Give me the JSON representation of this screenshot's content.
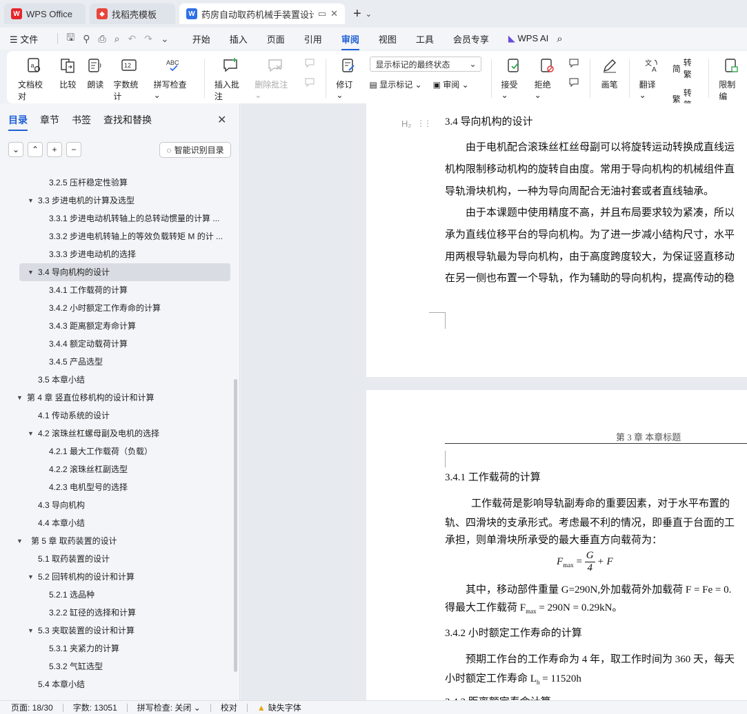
{
  "tabs": [
    {
      "label": "WPS Office"
    },
    {
      "label": "找稻壳模板"
    },
    {
      "label": "药房自动取药机械手装置设计"
    }
  ],
  "menu": {
    "file": "文件",
    "items": [
      "开始",
      "插入",
      "页面",
      "引用",
      "审阅",
      "视图",
      "工具",
      "会员专享"
    ],
    "wpsai": "WPS AI"
  },
  "ribbon": {
    "doc_check": "文档校对",
    "compare": "比较",
    "read": "朗读",
    "word_count": "字数统计",
    "spell_check": "拼写检查",
    "spell_icon_text": "ABC",
    "count_icon_text": "12",
    "insert_comment": "插入批注",
    "delete_comment": "删除批注",
    "revise": "修订",
    "display_mode": "显示标记的最终状态",
    "show_marks": "显示标记",
    "review": "审阅",
    "accept": "接受",
    "reject": "拒绝",
    "brush": "画笔",
    "translate": "翻译",
    "to_traditional": "转繁",
    "to_simplified": "转简",
    "restrict_edit": "限制编"
  },
  "nav": {
    "tabs": [
      "目录",
      "章节",
      "书签",
      "查找和替换"
    ],
    "smart_btn": "智能识别目录",
    "toc": [
      {
        "label": "3.2.5 压杆稳定性验算"
      },
      {
        "label": "3.3 步进电机的计算及选型"
      },
      {
        "label": "3.3.1 步进电动机转轴上的总转动惯量的计算 ..."
      },
      {
        "label": "3.3.2 步进电机转轴上的等效负载转矩 M 的计 ..."
      },
      {
        "label": "3.3.3 步进电动机的选择"
      },
      {
        "label": "3.4 导向机构的设计"
      },
      {
        "label": "3.4.1  工作载荷的计算"
      },
      {
        "label": "3.4.2 小时额定工作寿命的计算"
      },
      {
        "label": "3.4.3 距离额定寿命计算"
      },
      {
        "label": "3.4.4 额定动载荷计算"
      },
      {
        "label": "3.4.5  产品选型"
      },
      {
        "label": "3.5 本章小结"
      },
      {
        "label": "第 4 章  竖直位移机构的设计和计算"
      },
      {
        "label": "4.1 传动系统的设计"
      },
      {
        "label": "4.2 滚珠丝杠螺母副及电机的选择"
      },
      {
        "label": "4.2.1 最大工作载荷（负载）"
      },
      {
        "label": "4.2.2 滚珠丝杠副选型"
      },
      {
        "label": "4.2.3 电机型号的选择"
      },
      {
        "label": "4.3  导向机构"
      },
      {
        "label": "4.4  本章小结"
      },
      {
        "label": "第 5 章  取药装置的设计"
      },
      {
        "label": "5.1 取药装置的设计"
      },
      {
        "label": "5.2  回转机构的设计和计算"
      },
      {
        "label": "5.2.1 选品种"
      },
      {
        "label": "3.2.2 缸径的选择和计算"
      },
      {
        "label": "5.3  夹取装置的设计和计算"
      },
      {
        "label": "5.3.1  夹紧力的计算"
      },
      {
        "label": "5.3.2  气缸选型"
      },
      {
        "label": "5.4  本章小结"
      }
    ]
  },
  "doc": {
    "h2_marker": "H₂",
    "p1_heading": "3.4 导向机构的设计",
    "p1_lines": [
      "由于电机配合滚珠丝杠丝母副可以将旋转运动转换成直线运",
      "机构限制移动机构的旋转自由度。常用于导向机构的机械组件直",
      "导轨滑块机构，一种为导向周配合无油衬套或者直线轴承。",
      "由于本课题中使用精度不高，并且布局要求较为紧凑，所以",
      "承为直线位移平台的导向机构。为了进一步减小结构尺寸，水平",
      "用两根导轨最为导向机构，由于高度跨度较大，为保证竖直移动",
      "在另一侧也布置一个导轨，作为辅助的导向机构，提高传动的稳"
    ],
    "running_header": "第 3 章  本章标题",
    "sec341": "3.4.1  工作载荷的计算",
    "p2_lines": [
      "工作载荷是影响导轨副寿命的重要因素，对于水平布置的",
      "轨、四滑块的支承形式。考虑最不利的情况，即垂直于台面的工",
      "承担，则单滑块所承受的最大垂直方向载荷为："
    ],
    "formula": {
      "lhs": "F",
      "lhs_sub": "max",
      "num": "G",
      "den": "4",
      "tail": "+ F"
    },
    "p3_line1": "其中，移动部件重量 G=290N,外加载荷外加载荷 F = Fe = 0.",
    "p3_line2": "得最大工作载荷 F",
    "p3_line2_sub": "max",
    "p3_line2_tail": " = 290N = 0.29kN。",
    "sec342": "3.4.2 小时额定工作寿命的计算",
    "p4_line1": "预期工作台的工作寿命为 4 年，取工作时间为 360 天，每天",
    "p4_line2": "小时额定工作寿命 L",
    "p4_line2_sub": "h",
    "p4_line2_tail": " = 11520h",
    "sec343_partial": "3.4.3 距离额定寿命计算"
  },
  "status": {
    "page": "页面: 18/30",
    "words": "字数: 13051",
    "spell": "拼写检查: 关闭",
    "proof": "校对",
    "missing_font": "缺失字体"
  }
}
